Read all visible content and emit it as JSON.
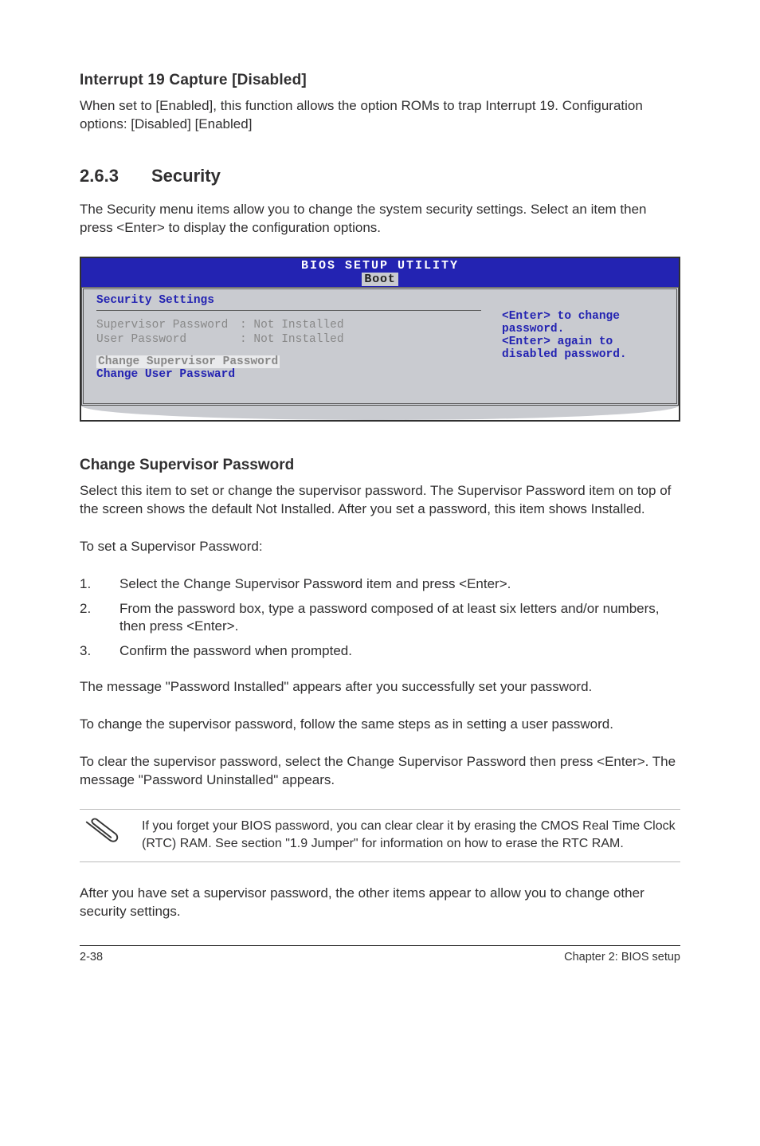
{
  "h1": "Interrupt 19 Capture [Disabled]",
  "p1": "When set to [Enabled], this function allows the option ROMs to trap Interrupt 19. Configuration options: [Disabled] [Enabled]",
  "section": {
    "num": "2.6.3",
    "title": "Security"
  },
  "p2": "The Security menu items allow you to change the system security settings. Select an item then press <Enter> to display the configuration options.",
  "bios": {
    "title_main": "BIOS SETUP UTILITY",
    "title_tab": "Boot",
    "heading": "Security Settings",
    "rows": [
      {
        "label": "Supervisor Password",
        "value": ": Not Installed"
      },
      {
        "label": "User Password",
        "value": ": Not Installed"
      }
    ],
    "menu1": "Change Supervisor Password",
    "menu2": "Change User Passward",
    "help": "<Enter> to change password.\n<Enter> again to disabled password."
  },
  "h2": "Change Supervisor Password",
  "p3": "Select this item to set or change the supervisor password. The Supervisor Password item on top of the screen shows the default Not Installed. After you set a password, this item shows Installed.",
  "p4": "To set a Supervisor Password:",
  "steps": [
    "Select the Change Supervisor Password item and press <Enter>.",
    "From the password box, type a password composed of at least six letters and/or numbers, then press <Enter>.",
    "Confirm the password when prompted."
  ],
  "p5": "The message \"Password Installed\" appears after you successfully set your password.",
  "p6": "To change the supervisor password, follow the same steps as in setting a user password.",
  "p7": "To clear the supervisor password, select the Change Supervisor Password then press <Enter>. The message \"Password Uninstalled\" appears.",
  "note": "If you forget your BIOS password, you can clear clear it by erasing the CMOS Real Time Clock (RTC) RAM. See section \"1.9 Jumper\" for information on how to erase the RTC RAM.",
  "p8": "After you have set a supervisor password, the other items appear to allow you to change other security settings.",
  "footer": {
    "left": "2-38",
    "right": "Chapter 2: BIOS setup"
  }
}
